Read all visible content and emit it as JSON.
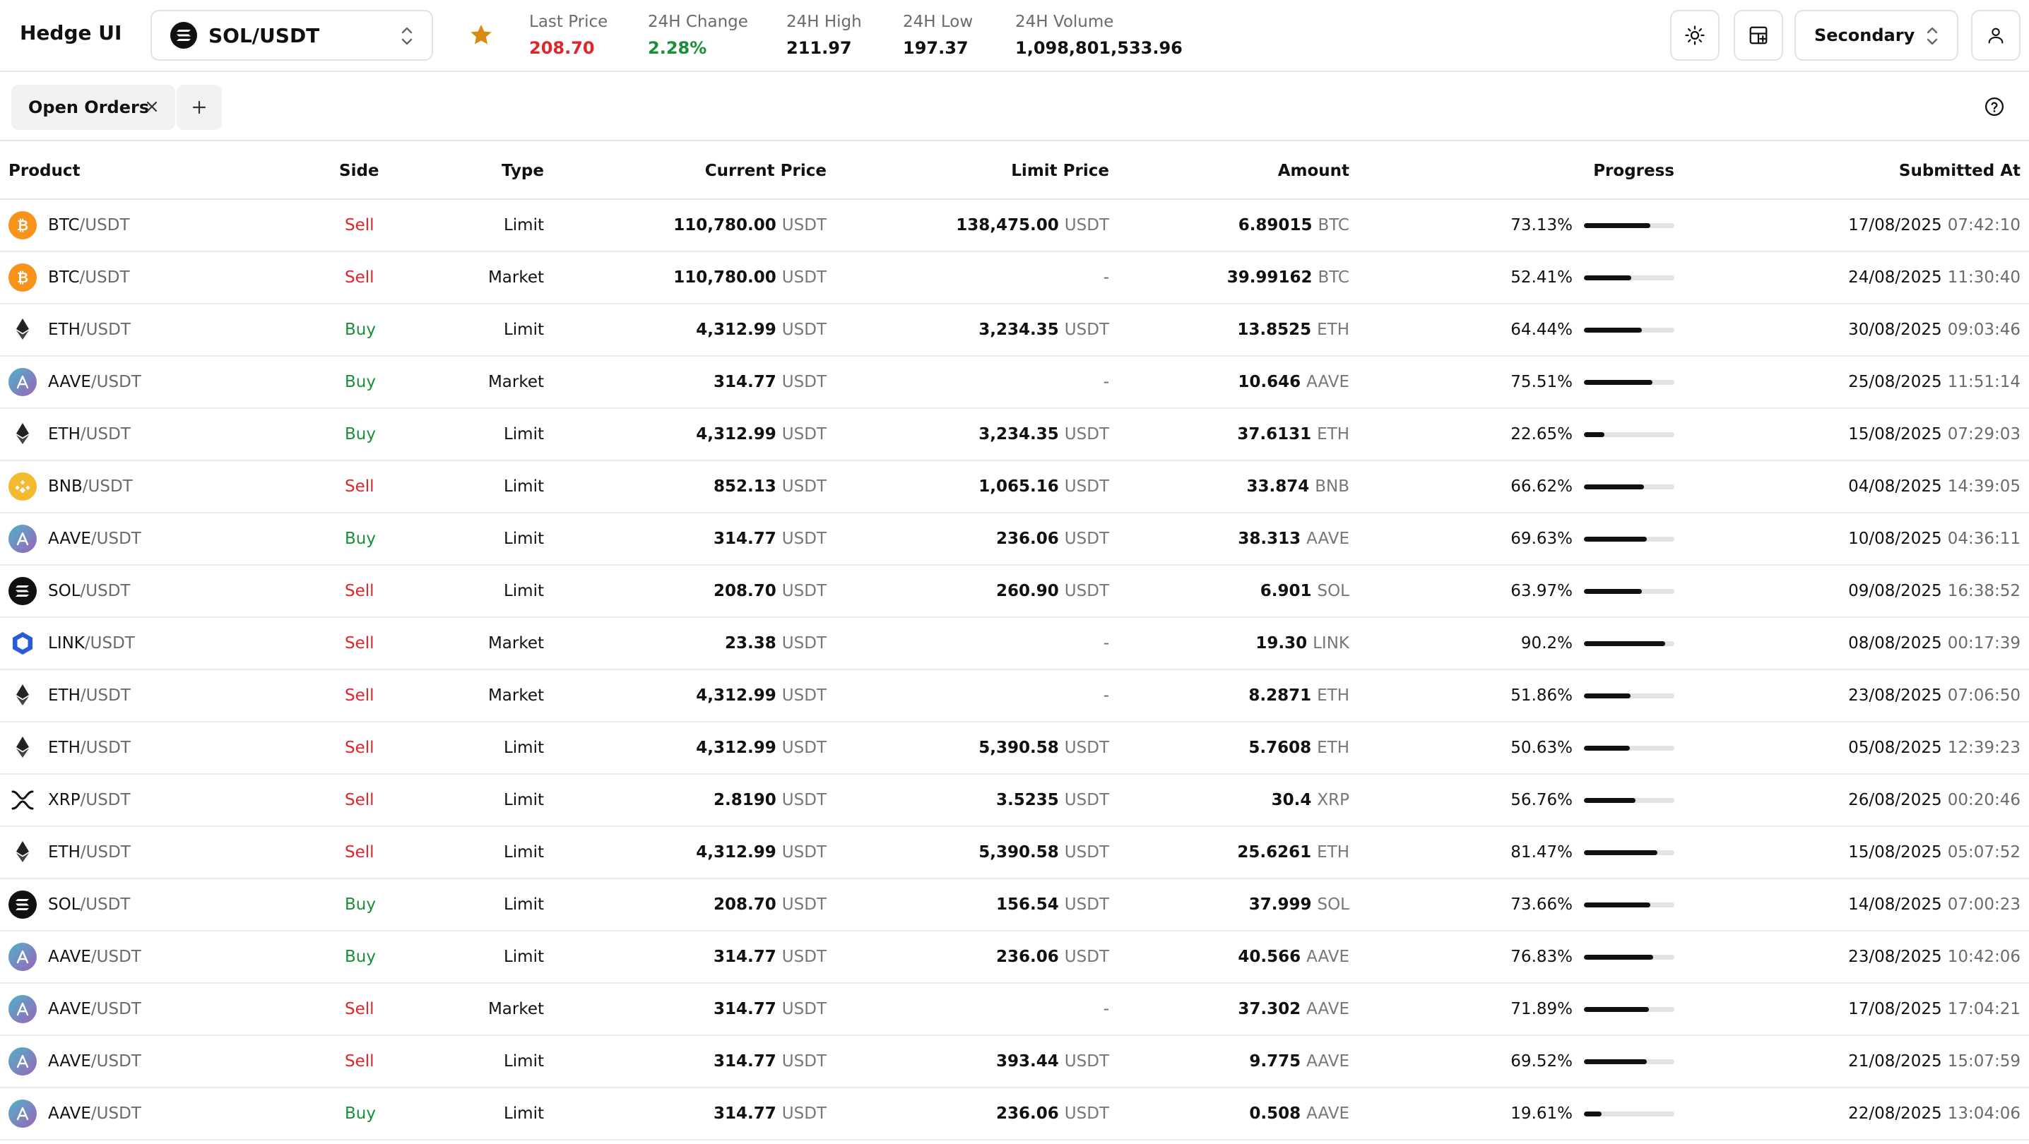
{
  "app": {
    "title": "Hedge UI"
  },
  "pair": {
    "name": "SOL/USDT",
    "icon": "sol-icon"
  },
  "stats": [
    {
      "label": "Last Price",
      "value": "208.70",
      "color": "#e0262b"
    },
    {
      "label": "24H Change",
      "value": "2.28%",
      "color": "#1a8f3a"
    },
    {
      "label": "24H High",
      "value": "211.97",
      "color": "#111111"
    },
    {
      "label": "24H Low",
      "value": "197.37",
      "color": "#111111"
    },
    {
      "label": "24H Volume",
      "value": "1,098,801,533.96",
      "color": "#111111"
    }
  ],
  "toolbar": {
    "mode_label": "Secondary"
  },
  "tabs": [
    {
      "label": "Open Orders"
    }
  ],
  "table": {
    "columns": [
      "Product",
      "Side",
      "Type",
      "Current Price",
      "Limit Price",
      "Amount",
      "Progress",
      "Submitted At"
    ],
    "rows": [
      {
        "coin": "btc",
        "base": "BTC",
        "quote": "/USDT",
        "side": "Sell",
        "type": "Limit",
        "cur": "110,780.00",
        "cur_unit": "USDT",
        "limit": "138,475.00",
        "limit_unit": "USDT",
        "amount": "6.89015",
        "amount_unit": "BTC",
        "progress": "73.13%",
        "progress_value": 73.13,
        "date": "17/08/2025",
        "time": "07:42:10"
      },
      {
        "coin": "btc",
        "base": "BTC",
        "quote": "/USDT",
        "side": "Sell",
        "type": "Market",
        "cur": "110,780.00",
        "cur_unit": "USDT",
        "limit": "-",
        "limit_unit": "",
        "amount": "39.99162",
        "amount_unit": "BTC",
        "progress": "52.41%",
        "progress_value": 52.41,
        "date": "24/08/2025",
        "time": "11:30:40"
      },
      {
        "coin": "eth",
        "base": "ETH",
        "quote": "/USDT",
        "side": "Buy",
        "type": "Limit",
        "cur": "4,312.99",
        "cur_unit": "USDT",
        "limit": "3,234.35",
        "limit_unit": "USDT",
        "amount": "13.8525",
        "amount_unit": "ETH",
        "progress": "64.44%",
        "progress_value": 64.44,
        "date": "30/08/2025",
        "time": "09:03:46"
      },
      {
        "coin": "aave",
        "base": "AAVE",
        "quote": "/USDT",
        "side": "Buy",
        "type": "Market",
        "cur": "314.77",
        "cur_unit": "USDT",
        "limit": "-",
        "limit_unit": "",
        "amount": "10.646",
        "amount_unit": "AAVE",
        "progress": "75.51%",
        "progress_value": 75.51,
        "date": "25/08/2025",
        "time": "11:51:14"
      },
      {
        "coin": "eth",
        "base": "ETH",
        "quote": "/USDT",
        "side": "Buy",
        "type": "Limit",
        "cur": "4,312.99",
        "cur_unit": "USDT",
        "limit": "3,234.35",
        "limit_unit": "USDT",
        "amount": "37.6131",
        "amount_unit": "ETH",
        "progress": "22.65%",
        "progress_value": 22.65,
        "date": "15/08/2025",
        "time": "07:29:03"
      },
      {
        "coin": "bnb",
        "base": "BNB",
        "quote": "/USDT",
        "side": "Sell",
        "type": "Limit",
        "cur": "852.13",
        "cur_unit": "USDT",
        "limit": "1,065.16",
        "limit_unit": "USDT",
        "amount": "33.874",
        "amount_unit": "BNB",
        "progress": "66.62%",
        "progress_value": 66.62,
        "date": "04/08/2025",
        "time": "14:39:05"
      },
      {
        "coin": "aave",
        "base": "AAVE",
        "quote": "/USDT",
        "side": "Buy",
        "type": "Limit",
        "cur": "314.77",
        "cur_unit": "USDT",
        "limit": "236.06",
        "limit_unit": "USDT",
        "amount": "38.313",
        "amount_unit": "AAVE",
        "progress": "69.63%",
        "progress_value": 69.63,
        "date": "10/08/2025",
        "time": "04:36:11"
      },
      {
        "coin": "sol",
        "base": "SOL",
        "quote": "/USDT",
        "side": "Sell",
        "type": "Limit",
        "cur": "208.70",
        "cur_unit": "USDT",
        "limit": "260.90",
        "limit_unit": "USDT",
        "amount": "6.901",
        "amount_unit": "SOL",
        "progress": "63.97%",
        "progress_value": 63.97,
        "date": "09/08/2025",
        "time": "16:38:52"
      },
      {
        "coin": "link",
        "base": "LINK",
        "quote": "/USDT",
        "side": "Sell",
        "type": "Market",
        "cur": "23.38",
        "cur_unit": "USDT",
        "limit": "-",
        "limit_unit": "",
        "amount": "19.30",
        "amount_unit": "LINK",
        "progress": "90.2%",
        "progress_value": 90.2,
        "date": "08/08/2025",
        "time": "00:17:39"
      },
      {
        "coin": "eth",
        "base": "ETH",
        "quote": "/USDT",
        "side": "Sell",
        "type": "Market",
        "cur": "4,312.99",
        "cur_unit": "USDT",
        "limit": "-",
        "limit_unit": "",
        "amount": "8.2871",
        "amount_unit": "ETH",
        "progress": "51.86%",
        "progress_value": 51.86,
        "date": "23/08/2025",
        "time": "07:06:50"
      },
      {
        "coin": "eth",
        "base": "ETH",
        "quote": "/USDT",
        "side": "Sell",
        "type": "Limit",
        "cur": "4,312.99",
        "cur_unit": "USDT",
        "limit": "5,390.58",
        "limit_unit": "USDT",
        "amount": "5.7608",
        "amount_unit": "ETH",
        "progress": "50.63%",
        "progress_value": 50.63,
        "date": "05/08/2025",
        "time": "12:39:23"
      },
      {
        "coin": "xrp",
        "base": "XRP",
        "quote": "/USDT",
        "side": "Sell",
        "type": "Limit",
        "cur": "2.8190",
        "cur_unit": "USDT",
        "limit": "3.5235",
        "limit_unit": "USDT",
        "amount": "30.4",
        "amount_unit": "XRP",
        "progress": "56.76%",
        "progress_value": 56.76,
        "date": "26/08/2025",
        "time": "00:20:46"
      },
      {
        "coin": "eth",
        "base": "ETH",
        "quote": "/USDT",
        "side": "Sell",
        "type": "Limit",
        "cur": "4,312.99",
        "cur_unit": "USDT",
        "limit": "5,390.58",
        "limit_unit": "USDT",
        "amount": "25.6261",
        "amount_unit": "ETH",
        "progress": "81.47%",
        "progress_value": 81.47,
        "date": "15/08/2025",
        "time": "05:07:52"
      },
      {
        "coin": "sol",
        "base": "SOL",
        "quote": "/USDT",
        "side": "Buy",
        "type": "Limit",
        "cur": "208.70",
        "cur_unit": "USDT",
        "limit": "156.54",
        "limit_unit": "USDT",
        "amount": "37.999",
        "amount_unit": "SOL",
        "progress": "73.66%",
        "progress_value": 73.66,
        "date": "14/08/2025",
        "time": "07:00:23"
      },
      {
        "coin": "aave",
        "base": "AAVE",
        "quote": "/USDT",
        "side": "Buy",
        "type": "Limit",
        "cur": "314.77",
        "cur_unit": "USDT",
        "limit": "236.06",
        "limit_unit": "USDT",
        "amount": "40.566",
        "amount_unit": "AAVE",
        "progress": "76.83%",
        "progress_value": 76.83,
        "date": "23/08/2025",
        "time": "10:42:06"
      },
      {
        "coin": "aave",
        "base": "AAVE",
        "quote": "/USDT",
        "side": "Sell",
        "type": "Market",
        "cur": "314.77",
        "cur_unit": "USDT",
        "limit": "-",
        "limit_unit": "",
        "amount": "37.302",
        "amount_unit": "AAVE",
        "progress": "71.89%",
        "progress_value": 71.89,
        "date": "17/08/2025",
        "time": "17:04:21"
      },
      {
        "coin": "aave",
        "base": "AAVE",
        "quote": "/USDT",
        "side": "Sell",
        "type": "Limit",
        "cur": "314.77",
        "cur_unit": "USDT",
        "limit": "393.44",
        "limit_unit": "USDT",
        "amount": "9.775",
        "amount_unit": "AAVE",
        "progress": "69.52%",
        "progress_value": 69.52,
        "date": "21/08/2025",
        "time": "15:07:59"
      },
      {
        "coin": "aave",
        "base": "AAVE",
        "quote": "/USDT",
        "side": "Buy",
        "type": "Limit",
        "cur": "314.77",
        "cur_unit": "USDT",
        "limit": "236.06",
        "limit_unit": "USDT",
        "amount": "0.508",
        "amount_unit": "AAVE",
        "progress": "19.61%",
        "progress_value": 19.61,
        "date": "22/08/2025",
        "time": "13:04:06"
      }
    ]
  },
  "colors": {
    "sell": "#e0262b",
    "buy": "#1a8f3a",
    "star": "#d98a0f",
    "btc": "#f7931a",
    "bnb": "#f3ba2f",
    "link": "#2a5ada",
    "aave": "#7a6fc0"
  }
}
